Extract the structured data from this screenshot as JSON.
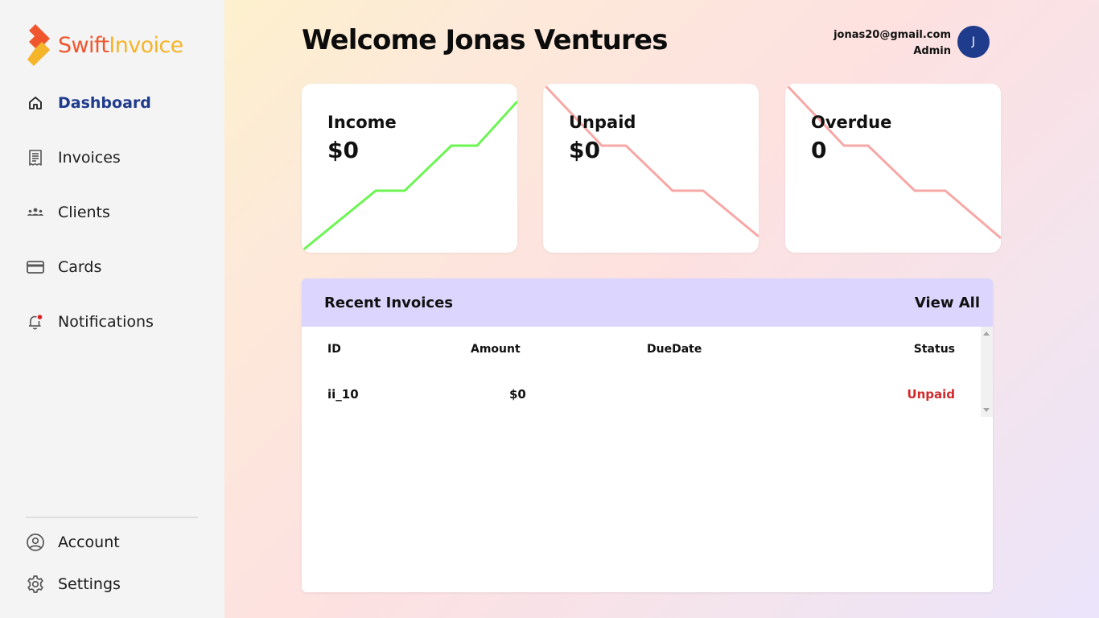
{
  "brand": {
    "part1": "Swift",
    "part2": "Invoice",
    "color1": "#f0562e",
    "color2": "#f5b52a"
  },
  "sidebar": {
    "items": [
      {
        "label": "Dashboard",
        "icon": "home-icon",
        "active": true
      },
      {
        "label": "Invoices",
        "icon": "receipt-icon"
      },
      {
        "label": "Clients",
        "icon": "users-icon"
      },
      {
        "label": "Cards",
        "icon": "credit-card-icon"
      },
      {
        "label": "Notifications",
        "icon": "bell-icon"
      }
    ],
    "bottom_items": [
      {
        "label": "Account",
        "icon": "user-circle-icon"
      },
      {
        "label": "Settings",
        "icon": "gear-icon"
      }
    ]
  },
  "header": {
    "welcome": "Welcome Jonas Ventures",
    "email": "jonas20@gmail.com",
    "role": "Admin",
    "avatar_initial": "J",
    "avatar_color": "#1f3b8c"
  },
  "stats": [
    {
      "title": "Income",
      "value": "$0",
      "trend": "up",
      "color": "#6cf552"
    },
    {
      "title": "Unpaid",
      "value": "$0",
      "trend": "down",
      "color": "#f7a8a6"
    },
    {
      "title": "Overdue",
      "value": "0",
      "trend": "down",
      "color": "#f7a8a6"
    }
  ],
  "recent_invoices": {
    "title": "Recent Invoices",
    "view_all": "View All",
    "header_color": "#dcd6fe",
    "columns": [
      "ID",
      "Amount",
      "DueDate",
      "Status"
    ],
    "rows": [
      {
        "id": "ii_10",
        "amount": "$0",
        "due_date": "",
        "status": "Unpaid"
      }
    ]
  }
}
